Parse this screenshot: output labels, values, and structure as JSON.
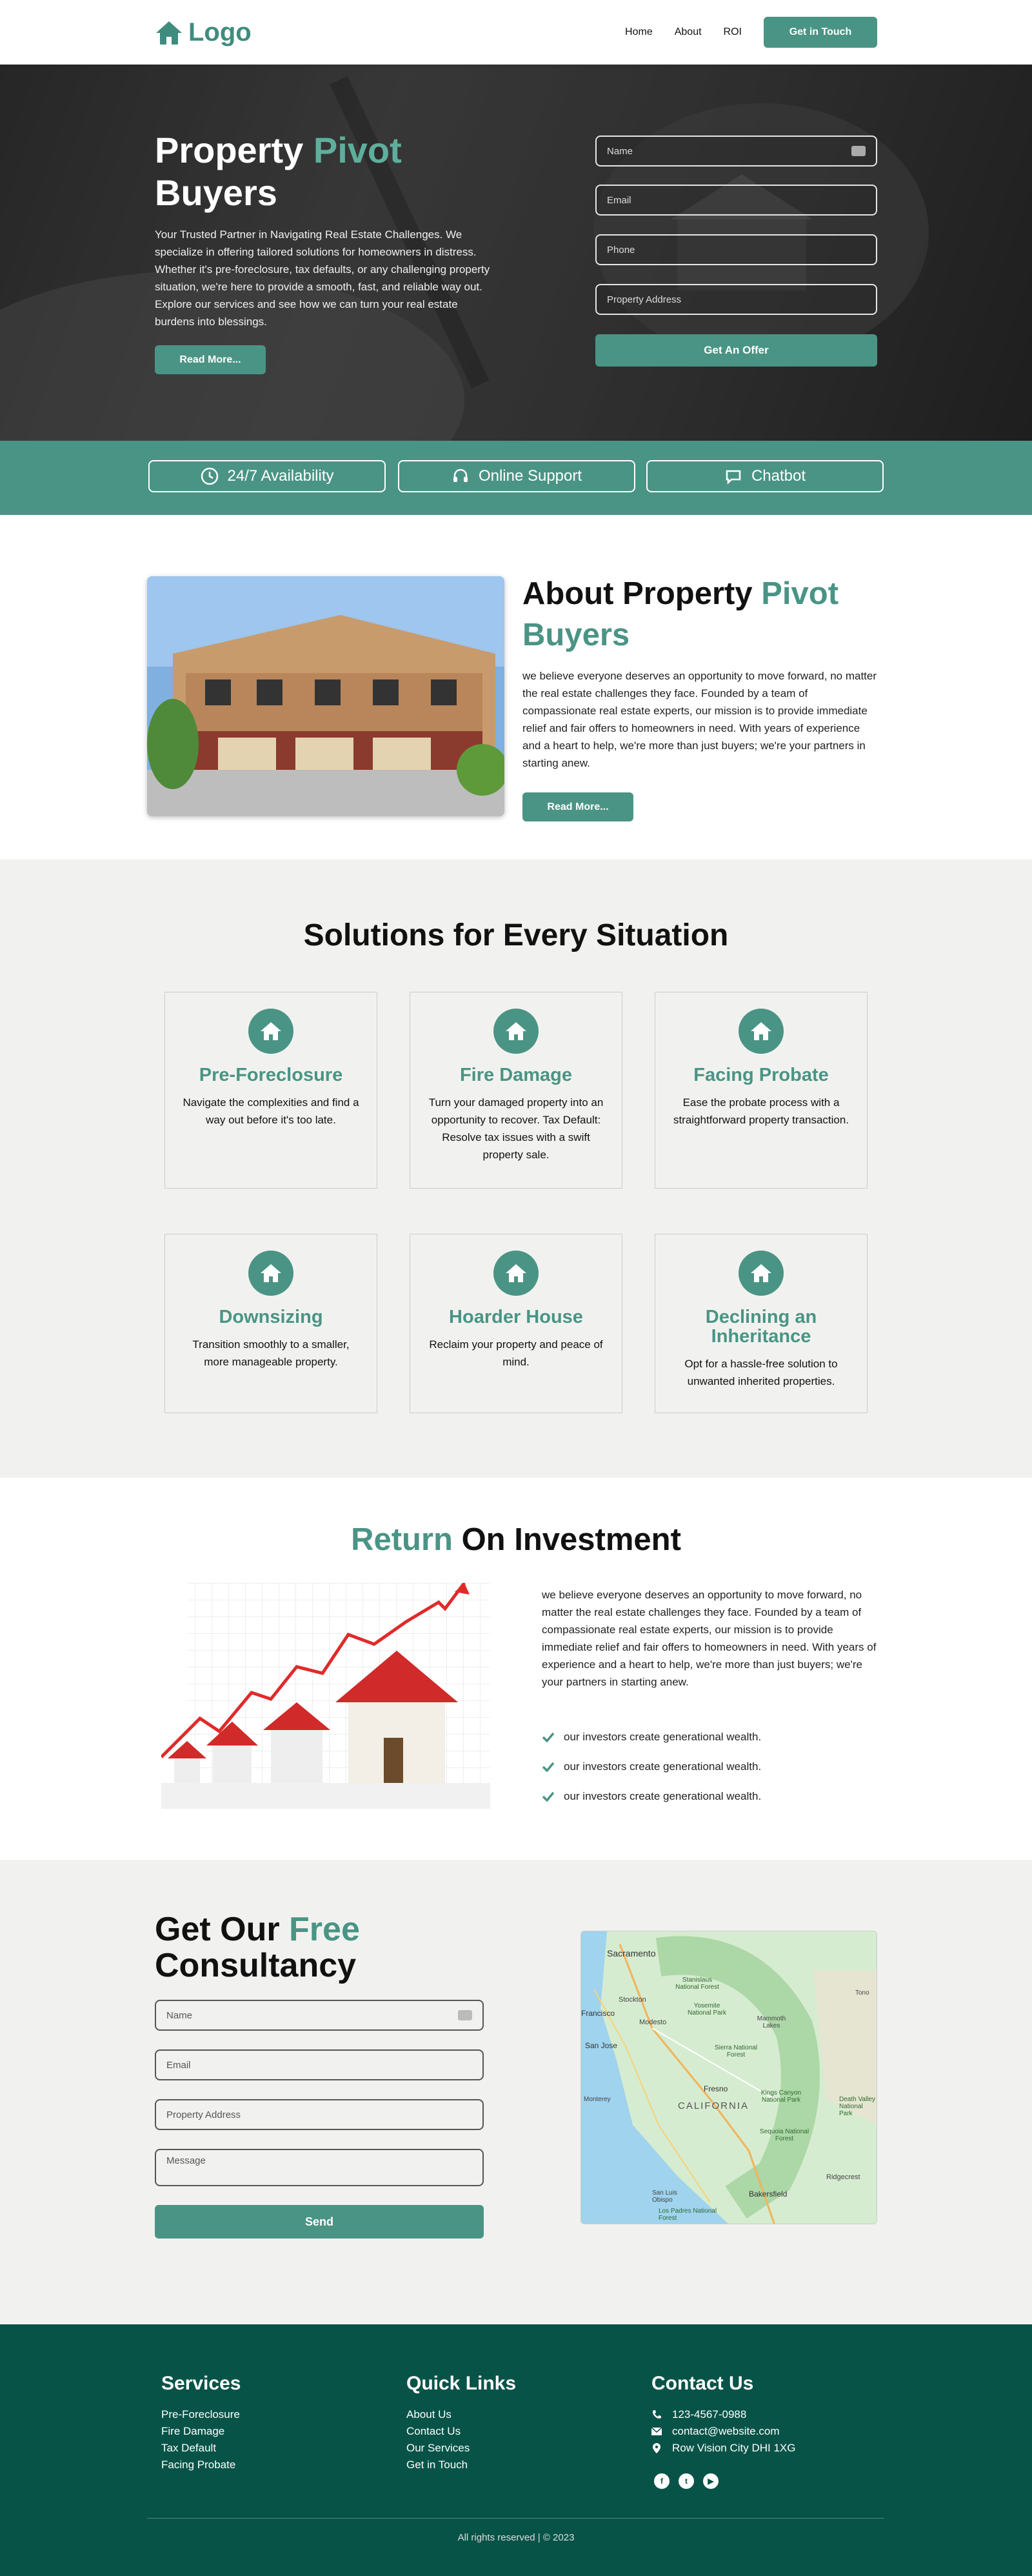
{
  "header": {
    "logo": "Logo",
    "nav": [
      "Home",
      "About",
      "ROI"
    ],
    "cta": "Get in Touch"
  },
  "hero": {
    "title_a": "Property ",
    "title_b": "Pivot",
    "title_c": "Buyers",
    "desc": "Your Trusted Partner in Navigating Real Estate Challenges. We specialize in offering tailored solutions for homeowners in distress. Whether it's pre-foreclosure, tax defaults, or any challenging property situation, we're here to provide a smooth, fast, and reliable way out. Explore our services and see how we can turn your real estate burdens into blessings.",
    "read_more": "Read More...",
    "form": {
      "name": "Name",
      "email": "Email",
      "phone": "Phone",
      "address": "Property Address",
      "submit": "Get An Offer"
    }
  },
  "badges": [
    "24/7 Availability",
    "Online Support",
    "Chatbot"
  ],
  "about": {
    "title_a": "About Property ",
    "title_b": "Pivot",
    "title_c": "Buyers",
    "text": "we believe everyone deserves an opportunity to move forward, no matter the real estate challenges they face. Founded by a team of compassionate real estate experts, our mission is to provide immediate relief and fair offers to homeowners in need. With years of experience and a heart to help, we're more than just buyers; we're your partners in starting anew.",
    "read_more": "Read More..."
  },
  "solutions": {
    "title": "Solutions for Every Situation",
    "cards": [
      {
        "title": "Pre-Foreclosure",
        "text": "Navigate the complexities and find a way out before it's too late."
      },
      {
        "title": "Fire Damage",
        "text": "Turn your damaged property into an opportunity to recover. Tax Default: Resolve tax issues with a swift property sale."
      },
      {
        "title": "Facing Probate",
        "text": "Ease the probate process with a straightforward property transaction."
      },
      {
        "title": "Downsizing",
        "text": "Transition smoothly to a smaller, more manageable property."
      },
      {
        "title": "Hoarder House",
        "text": "Reclaim your property and peace of mind."
      },
      {
        "title": "Declining an Inheritance",
        "text": "Opt for a hassle-free solution to unwanted inherited properties."
      }
    ]
  },
  "roi": {
    "title_a": "Return",
    "title_b": " On Investment",
    "text": "we believe everyone deserves an opportunity to move forward, no matter the real estate challenges they face. Founded by a team of compassionate real estate experts, our mission is to provide immediate relief and fair offers to homeowners in need. With years of experience and a heart to help, we're more than just buyers; we're your partners in starting anew.",
    "points": [
      "our investors create generational wealth.",
      "our investors create generational wealth.",
      "our investors create generational wealth."
    ]
  },
  "consult": {
    "title_a": "Get Our ",
    "title_b": "Free",
    "title_c": "Consultancy",
    "form": {
      "name": "Name",
      "email": "Email",
      "address": "Property Address",
      "message": "Message",
      "submit": "Send"
    },
    "map": {
      "labels": [
        "Sacramento",
        "Stockton",
        "Modesto",
        "San Jose",
        "Fresno",
        "CALIFORNIA",
        "Bakersfield",
        "Ridgecrest",
        "Monterey",
        "Yosemite National Park",
        "Kings Canyon National Park",
        "Sequoia National Forest",
        "Stanislaus National Forest",
        "Sierra National Forest",
        "Mammoth Lakes",
        "Death Valley National Park",
        "San Luis Obispo",
        "Los Padres National Forest",
        "Francisco",
        "Tono"
      ]
    }
  },
  "footer": {
    "services_title": "Services",
    "services": [
      "Pre-Foreclosure",
      "Fire Damage",
      "Tax Default",
      "Facing Probate"
    ],
    "links_title": "Quick Links",
    "links": [
      "About Us",
      "Contact Us",
      "Our Services",
      "Get in Touch"
    ],
    "contact_title": "Contact Us",
    "phone": "123-4567-0988",
    "email": "contact@website.com",
    "address": "Row Vision City DHI 1XG",
    "copyright": "All rights reserved | © 2023"
  },
  "colors": {
    "accent": "#4a9485",
    "footer": "#085348",
    "section_bg": "#f1f2ef"
  },
  "icons": [
    "house-logo-icon",
    "contact-card-icon",
    "clock-icon",
    "headset-icon",
    "chat-icon",
    "house-icon",
    "check-icon",
    "phone-icon",
    "mail-icon",
    "location-icon",
    "facebook-icon",
    "twitter-icon",
    "youtube-icon"
  ]
}
